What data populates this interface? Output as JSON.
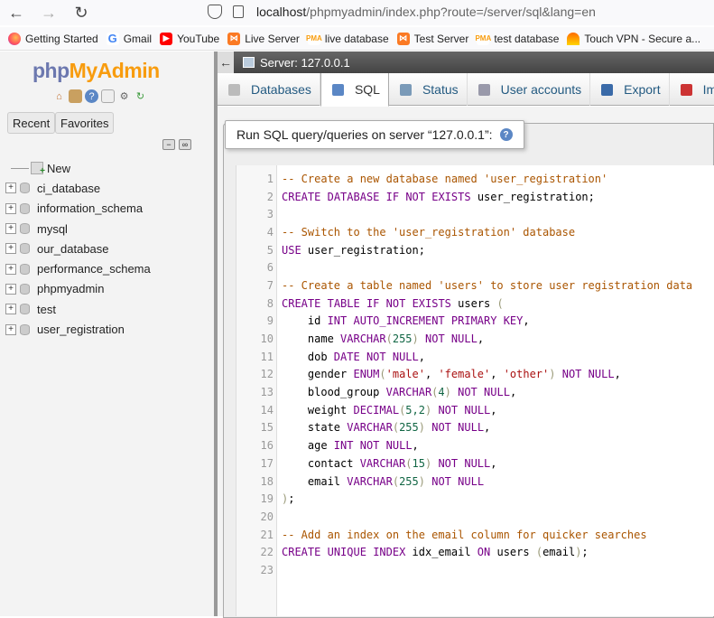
{
  "browser": {
    "url_host": "localhost",
    "url_path": "/phpmyadmin/index.php?route=/server/sql&lang=en",
    "bookmarks": [
      {
        "label": "Getting Started",
        "icon": "firefox-icon"
      },
      {
        "label": "Gmail",
        "icon": "google-icon"
      },
      {
        "label": "YouTube",
        "icon": "youtube-icon"
      },
      {
        "label": "Live Server",
        "icon": "xampp-icon"
      },
      {
        "label": "live database",
        "icon": "phpmyadmin-icon"
      },
      {
        "label": "Test Server",
        "icon": "xampp-icon"
      },
      {
        "label": "test database",
        "icon": "phpmyadmin-icon"
      },
      {
        "label": "Touch VPN - Secure a...",
        "icon": "vpn-icon"
      }
    ]
  },
  "sidebar": {
    "logo_php": "php",
    "logo_my": "MyAdmin",
    "recent_label": "Recent",
    "favorites_label": "Favorites",
    "new_label": "New",
    "databases": [
      "ci_database",
      "information_schema",
      "mysql",
      "our_database",
      "performance_schema",
      "phpmyadmin",
      "test",
      "user_registration"
    ]
  },
  "server_bar": {
    "label": "Server: 127.0.0.1"
  },
  "tabs": [
    {
      "label": "Databases",
      "active": false
    },
    {
      "label": "SQL",
      "active": true
    },
    {
      "label": "Status",
      "active": false
    },
    {
      "label": "User accounts",
      "active": false
    },
    {
      "label": "Export",
      "active": false
    },
    {
      "label": "Im",
      "active": false
    }
  ],
  "panel": {
    "title": "Run SQL query/queries on server “127.0.0.1”:",
    "help_glyph": "?"
  },
  "code": [
    "-- Create a new database named 'user_registration'",
    "CREATE DATABASE IF NOT EXISTS user_registration;",
    "",
    "-- Switch to the 'user_registration' database",
    "USE user_registration;",
    "",
    "-- Create a table named 'users' to store user registration data",
    "CREATE TABLE IF NOT EXISTS users (",
    "    id INT AUTO_INCREMENT PRIMARY KEY,",
    "    name VARCHAR(255) NOT NULL,",
    "    dob DATE NOT NULL,",
    "    gender ENUM('male', 'female', 'other') NOT NULL,",
    "    blood_group VARCHAR(4) NOT NULL,",
    "    weight DECIMAL(5,2) NOT NULL,",
    "    state VARCHAR(255) NOT NULL,",
    "    age INT NOT NULL,",
    "    contact VARCHAR(15) NOT NULL,",
    "    email VARCHAR(255) NOT NULL",
    ");",
    "",
    "-- Add an index on the email column for quicker searches",
    "CREATE UNIQUE INDEX idx_email ON users (email);",
    ""
  ]
}
